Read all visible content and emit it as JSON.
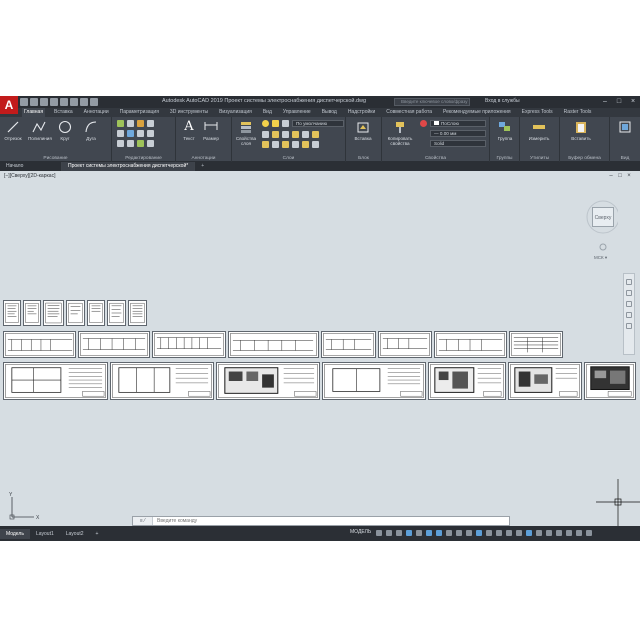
{
  "app": {
    "logo": "A",
    "title": "Autodesk AutoCAD 2019   Проект системы электроснабжения диспетчерской.dwg",
    "search_placeholder": "Введите ключевое слово/фразу",
    "signin": "Вход в службы",
    "colors": {
      "accent": "#c21b1b",
      "ribbon": "#414750",
      "canvas": "#d6dde2",
      "blue": "#5d9fd8"
    }
  },
  "ribbon_tabs": [
    "Главная",
    "Вставка",
    "Аннотации",
    "Параметризация",
    "3D инструменты",
    "Визуализация",
    "Вид",
    "Управление",
    "Вывод",
    "Надстройки",
    "Совместная работа",
    "Рекомендуемые приложения",
    "Express Tools",
    "Raster Tools"
  ],
  "ribbon": {
    "draw": {
      "label": "Рисование",
      "tools": [
        "Отрезок",
        "Полилиния",
        "Круг",
        "Дуга"
      ]
    },
    "modify": {
      "label": "Редактирование"
    },
    "annotation": {
      "label": "Аннотации",
      "tools": [
        "Текст",
        "Размер"
      ]
    },
    "layers": {
      "label": "Слои",
      "tool": "Свойства слоя",
      "combo": "По умолчанию"
    },
    "block": {
      "label": "Блок",
      "tool": "Вставка"
    },
    "properties": {
      "label": "Свойства",
      "tool": "Копировать свойства",
      "combo1": "ПоСлою",
      "combo2": "— 0.00 мм",
      "combo3": "Solid"
    },
    "groups": {
      "label": "Группы",
      "tool": "Группа"
    },
    "utilities": {
      "label": "Утилиты",
      "tool": "Измерить"
    },
    "clipboard": {
      "label": "Буфер обмена",
      "tool": "Вставить"
    },
    "view": {
      "label": "Вид"
    }
  },
  "file_tabs": [
    "Начало",
    "Проект системы электроснабжения диспетчерской*"
  ],
  "canvas": {
    "view_label": "[−][Сверху][2D-каркас]",
    "viewcube_face": "Сверху",
    "wcs": "МСК ▾",
    "ucs_y": "Y",
    "ucs_x": "X"
  },
  "command": {
    "placeholder": "Введите команду",
    "prefix": "≡ ⁄"
  },
  "layout_tabs": [
    "Модель",
    "Layout1",
    "Layout2"
  ],
  "status": {
    "model": "МОДЕЛЬ"
  }
}
